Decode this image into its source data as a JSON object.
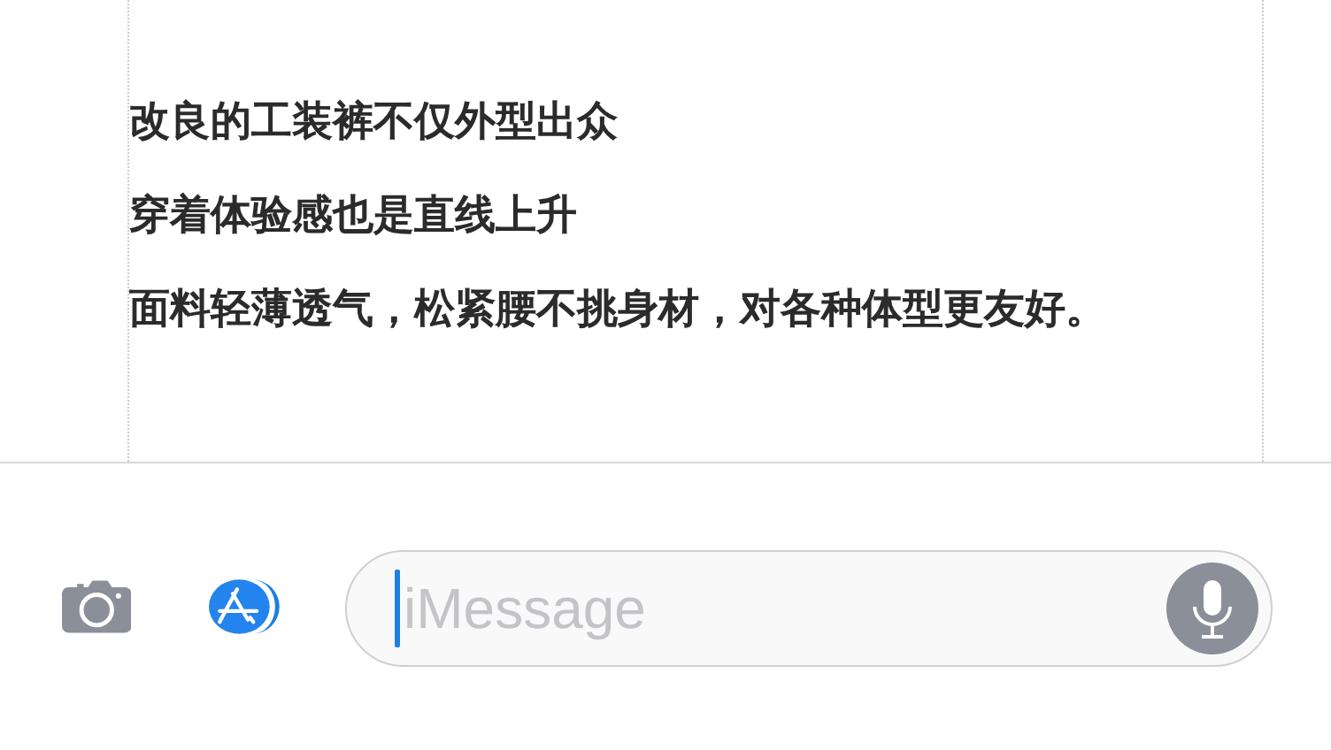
{
  "message_lines": [
    "改良的工装裤不仅外型出众",
    "穿着体验感也是直线上升",
    "面料轻薄透气，松紧腰不挑身材，对各种体型更友好。"
  ],
  "input": {
    "placeholder": "iMessage"
  }
}
